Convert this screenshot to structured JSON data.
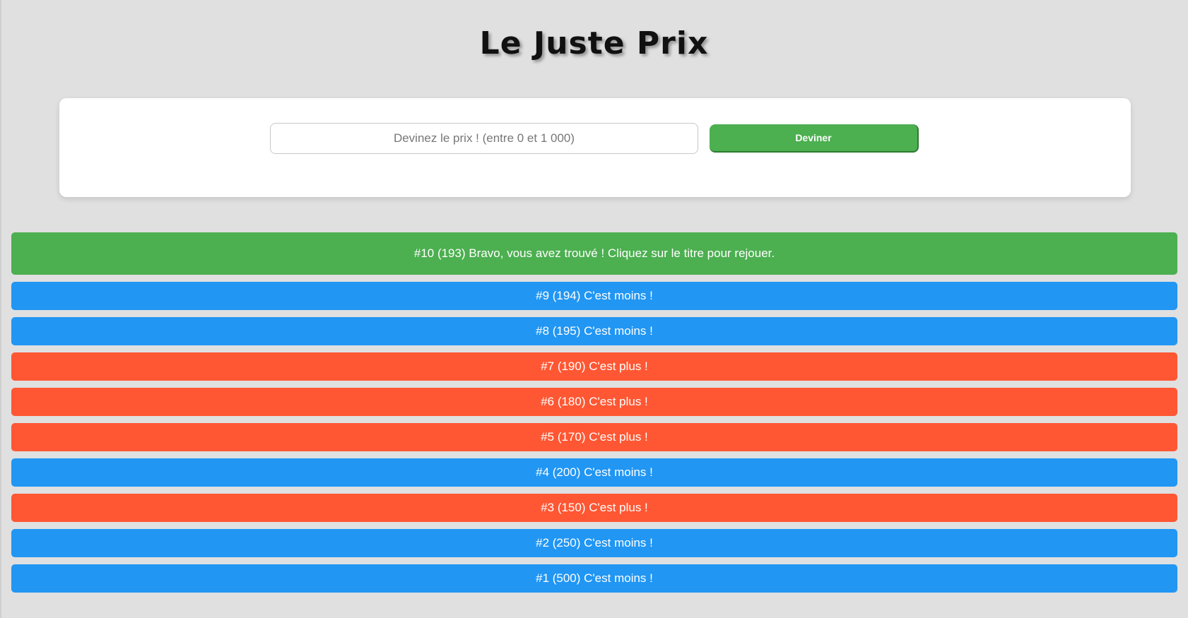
{
  "header": {
    "title": "Le Juste Prix"
  },
  "form": {
    "placeholder": "Devinez le prix ! (entre 0 et 1 000)",
    "value": "",
    "button_label": "Deviner"
  },
  "colors": {
    "win": "#4caf50",
    "less": "#2196f3",
    "more": "#ff5733"
  },
  "results": [
    {
      "type": "win",
      "text": "#10 (193) Bravo, vous avez trouvé ! Cliquez sur le titre pour rejouer."
    },
    {
      "type": "less",
      "text": "#9 (194) C'est moins !"
    },
    {
      "type": "less",
      "text": "#8 (195) C'est moins !"
    },
    {
      "type": "more",
      "text": "#7 (190) C'est plus !"
    },
    {
      "type": "more",
      "text": "#6 (180) C'est plus !"
    },
    {
      "type": "more",
      "text": "#5 (170) C'est plus !"
    },
    {
      "type": "less",
      "text": "#4 (200) C'est moins !"
    },
    {
      "type": "more",
      "text": "#3 (150) C'est plus !"
    },
    {
      "type": "less",
      "text": "#2 (250) C'est moins !"
    },
    {
      "type": "less",
      "text": "#1 (500) C'est moins !"
    }
  ]
}
